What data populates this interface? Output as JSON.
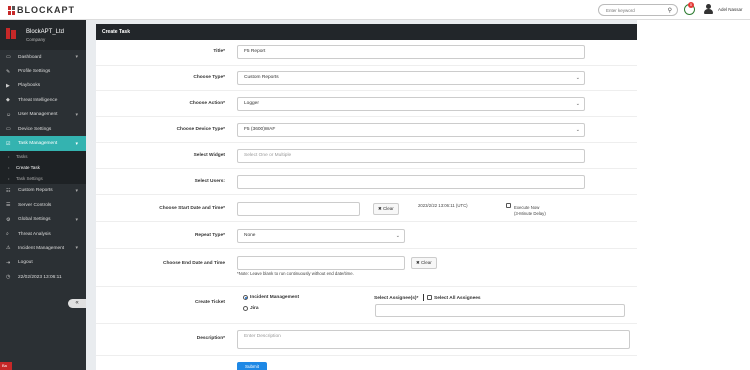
{
  "topbar": {
    "logo_text": "BLOCKAPT",
    "search_placeholder": "Enter keyword",
    "notification_count": "0",
    "user_name": "Adel Nassar"
  },
  "sidebar": {
    "company_name": "BlockAPT_Ltd",
    "company_sub": "Company",
    "items": [
      {
        "label": "Dashboard",
        "icon": "monitor-icon",
        "chevron": true
      },
      {
        "label": "Profile Settings",
        "icon": "edit-icon",
        "chevron": false
      },
      {
        "label": "Playbooks",
        "icon": "video-icon",
        "chevron": false
      },
      {
        "label": "Threat Intelligence",
        "icon": "shield-icon",
        "chevron": false
      },
      {
        "label": "User Management",
        "icon": "users-icon",
        "chevron": true
      },
      {
        "label": "Device Settings",
        "icon": "laptop-icon",
        "chevron": false
      },
      {
        "label": "Task Management",
        "icon": "tasks-icon",
        "chevron": true,
        "active": true
      }
    ],
    "sub_items": [
      {
        "label": "Tasks"
      },
      {
        "label": "Create Task",
        "current": true
      },
      {
        "label": "Task Settings"
      }
    ],
    "items_after": [
      {
        "label": "Custom Reports",
        "icon": "file-icon",
        "chevron": true
      },
      {
        "label": "Server Controls",
        "icon": "server-icon",
        "chevron": false
      },
      {
        "label": "Global Settings",
        "icon": "gear-icon",
        "chevron": true
      },
      {
        "label": "Threat Analysis",
        "icon": "search-icon",
        "chevron": false
      },
      {
        "label": "Incident Management",
        "icon": "alert-icon",
        "chevron": true
      },
      {
        "label": "Logout",
        "icon": "logout-icon",
        "chevron": false
      },
      {
        "label": "22/02/2023 13:06:11",
        "icon": "clock-icon",
        "chevron": false
      }
    ],
    "collapse_glyph": "«",
    "corner_text": "Ba"
  },
  "panel": {
    "header": "Create Task",
    "title_label": "Title*",
    "title_value": "F5 Report",
    "choose_type_label": "Choose Type*",
    "choose_type_value": "Custom Reports",
    "choose_action_label": "Choose Action*",
    "choose_action_value": "Logger",
    "choose_device_label": "Choose Device Type*",
    "choose_device_value": "F5 (3600)WAF",
    "widget_label": "Select Widget",
    "widget_placeholder": "Select One or Multiple",
    "users_label": "Select Users:",
    "start_label": "Choose Start Date and Time*",
    "clear_label": "Clear",
    "utc_time": "2023/2/22 13:06:11 (UTC)",
    "execute_now": "Execute Now",
    "execute_delay": "(3-Minute Delay)",
    "repeat_label": "Repeat Type*",
    "repeat_value": "None",
    "end_label": "Choose End Date and Time",
    "end_note": "*Note: Leave blank to run continuously without end date/time.",
    "ticket_label": "Create Ticket",
    "ticket_options": [
      "Incident Management",
      "Jira"
    ],
    "assignee_label": "Select Assignee(s)*",
    "all_assignees": "Select All Assignees",
    "description_label": "Description*",
    "description_placeholder": "Enter Description",
    "submit_label": "Submit"
  }
}
